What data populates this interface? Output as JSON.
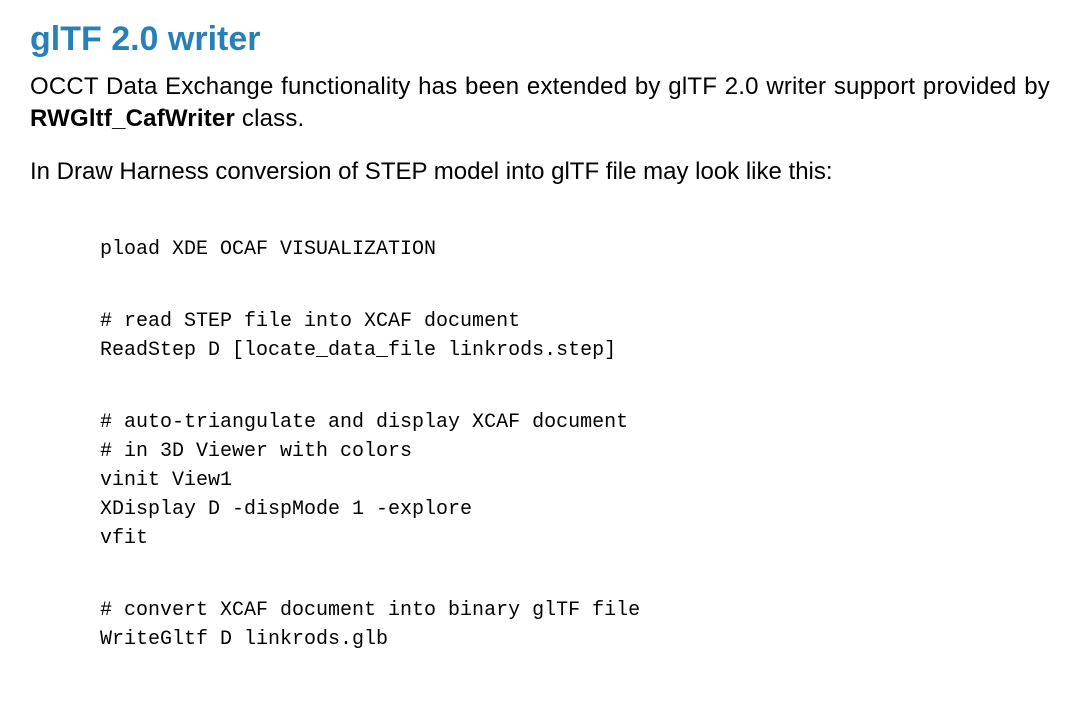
{
  "heading": "glTF 2.0 writer",
  "para1_before": "OCCT Data Exchange functionality has been extended by glTF 2.0 writer support provided by ",
  "para1_bold": "RWGltf_CafWriter",
  "para1_after": " class.",
  "para2": "In Draw Harness conversion of STEP model into glTF file may look like this:",
  "code": {
    "g1": "pload XDE OCAF VISUALIZATION",
    "g2l1": "# read STEP file into XCAF document",
    "g2l2": "ReadStep D [locate_data_file linkrods.step]",
    "g3l1": "# auto-triangulate and display XCAF document",
    "g3l2": "# in 3D Viewer with colors",
    "g3l3": "vinit View1",
    "g3l4": "XDisplay D -dispMode 1 -explore",
    "g3l5": "vfit",
    "g4l1": "# convert XCAF document into binary glTF file",
    "g4l2": "WriteGltf D linkrods.glb"
  }
}
